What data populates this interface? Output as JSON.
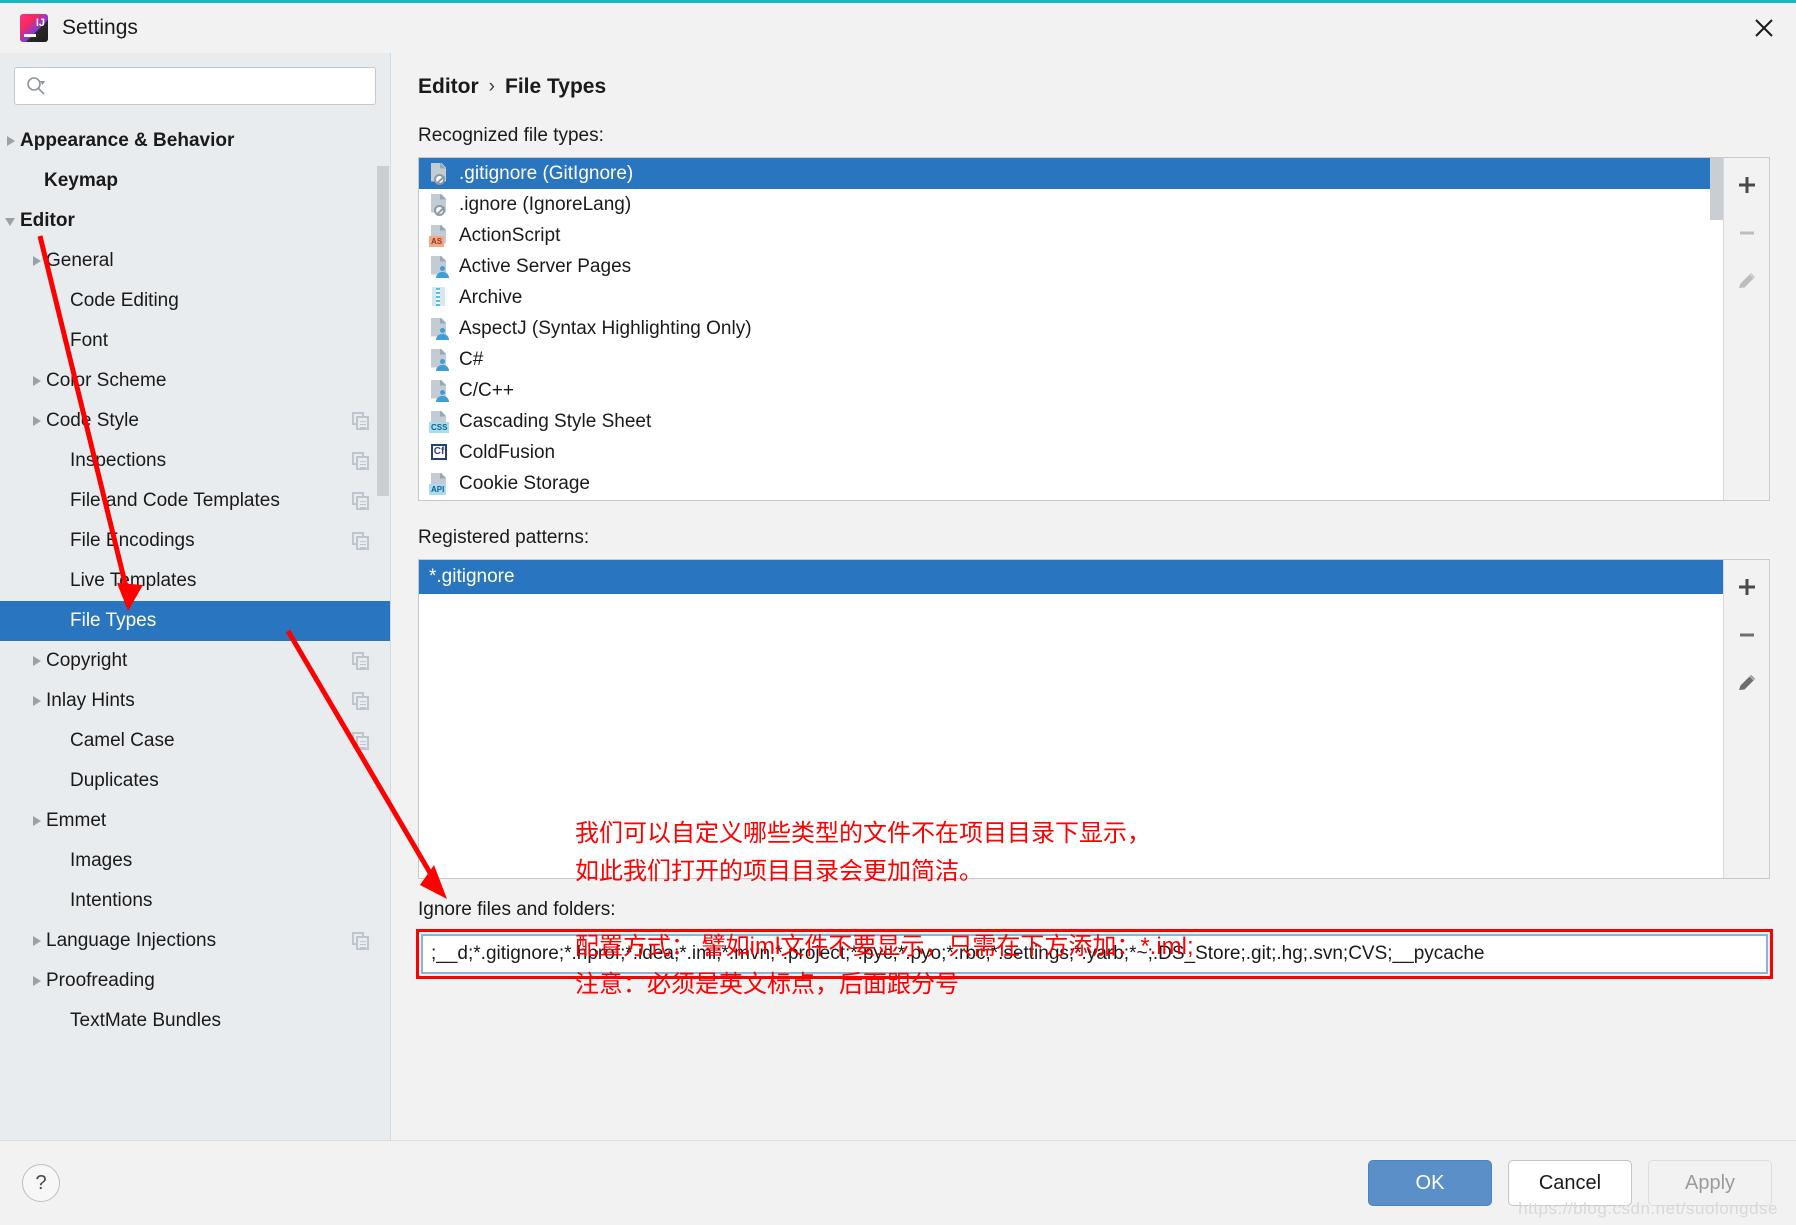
{
  "window": {
    "title": "Settings",
    "close_icon": "close-icon",
    "logo": "intellij-idea-logo"
  },
  "sidebar": {
    "search": {
      "placeholder": "",
      "value": "",
      "icon": "search-icon"
    },
    "items": [
      {
        "label": "Appearance & Behavior",
        "arrow": "closed",
        "bold": true,
        "indent": 20,
        "copy": false,
        "selected": false
      },
      {
        "label": "Keymap",
        "arrow": "none",
        "bold": true,
        "indent": 44,
        "copy": false,
        "selected": false
      },
      {
        "label": "Editor",
        "arrow": "open",
        "bold": true,
        "indent": 20,
        "copy": false,
        "selected": false
      },
      {
        "label": "General",
        "arrow": "closed",
        "bold": false,
        "indent": 46,
        "copy": false,
        "selected": false
      },
      {
        "label": "Code Editing",
        "arrow": "none",
        "bold": false,
        "indent": 70,
        "copy": false,
        "selected": false
      },
      {
        "label": "Font",
        "arrow": "none",
        "bold": false,
        "indent": 70,
        "copy": false,
        "selected": false
      },
      {
        "label": "Color Scheme",
        "arrow": "closed",
        "bold": false,
        "indent": 46,
        "copy": false,
        "selected": false
      },
      {
        "label": "Code Style",
        "arrow": "closed",
        "bold": false,
        "indent": 46,
        "copy": true,
        "selected": false
      },
      {
        "label": "Inspections",
        "arrow": "none",
        "bold": false,
        "indent": 70,
        "copy": true,
        "selected": false
      },
      {
        "label": "File and Code Templates",
        "arrow": "none",
        "bold": false,
        "indent": 70,
        "copy": true,
        "selected": false
      },
      {
        "label": "File Encodings",
        "arrow": "none",
        "bold": false,
        "indent": 70,
        "copy": true,
        "selected": false
      },
      {
        "label": "Live Templates",
        "arrow": "none",
        "bold": false,
        "indent": 70,
        "copy": false,
        "selected": false
      },
      {
        "label": "File Types",
        "arrow": "none",
        "bold": false,
        "indent": 70,
        "copy": false,
        "selected": true
      },
      {
        "label": "Copyright",
        "arrow": "closed",
        "bold": false,
        "indent": 46,
        "copy": true,
        "selected": false
      },
      {
        "label": "Inlay Hints",
        "arrow": "closed",
        "bold": false,
        "indent": 46,
        "copy": true,
        "selected": false
      },
      {
        "label": "Camel Case",
        "arrow": "none",
        "bold": false,
        "indent": 70,
        "copy": true,
        "selected": false
      },
      {
        "label": "Duplicates",
        "arrow": "none",
        "bold": false,
        "indent": 70,
        "copy": false,
        "selected": false
      },
      {
        "label": "Emmet",
        "arrow": "closed",
        "bold": false,
        "indent": 46,
        "copy": false,
        "selected": false
      },
      {
        "label": "Images",
        "arrow": "none",
        "bold": false,
        "indent": 70,
        "copy": false,
        "selected": false
      },
      {
        "label": "Intentions",
        "arrow": "none",
        "bold": false,
        "indent": 70,
        "copy": false,
        "selected": false
      },
      {
        "label": "Language Injections",
        "arrow": "closed",
        "bold": false,
        "indent": 46,
        "copy": true,
        "selected": false
      },
      {
        "label": "Proofreading",
        "arrow": "closed",
        "bold": false,
        "indent": 46,
        "copy": false,
        "selected": false
      },
      {
        "label": "TextMate Bundles",
        "arrow": "none",
        "bold": false,
        "indent": 70,
        "copy": false,
        "selected": false
      }
    ]
  },
  "main": {
    "breadcrumb": {
      "root": "Editor",
      "separator": "›",
      "leaf": "File Types"
    },
    "recognized": {
      "label": "Recognized file types:",
      "items": [
        {
          "name": ".gitignore (GitIgnore)",
          "icon": "file-ban-icon",
          "selected": true
        },
        {
          "name": ".ignore (IgnoreLang)",
          "icon": "file-ban-icon",
          "selected": false
        },
        {
          "name": "ActionScript",
          "icon": "file-as-icon",
          "selected": false
        },
        {
          "name": "Active Server Pages",
          "icon": "file-person-icon",
          "selected": false
        },
        {
          "name": "Archive",
          "icon": "file-archive-icon",
          "selected": false
        },
        {
          "name": "AspectJ (Syntax Highlighting Only)",
          "icon": "file-person-icon",
          "selected": false
        },
        {
          "name": "C#",
          "icon": "file-person-icon",
          "selected": false
        },
        {
          "name": "C/C++",
          "icon": "file-person-icon",
          "selected": false
        },
        {
          "name": "Cascading Style Sheet",
          "icon": "file-css-icon",
          "selected": false
        },
        {
          "name": "ColdFusion",
          "icon": "file-cf-icon",
          "selected": false
        },
        {
          "name": "Cookie Storage",
          "icon": "file-api-icon",
          "selected": false
        }
      ],
      "tools": [
        {
          "name": "add-file-type-button",
          "icon": "plus-icon",
          "enabled": true
        },
        {
          "name": "remove-file-type-button",
          "icon": "minus-icon",
          "enabled": false
        },
        {
          "name": "edit-file-type-button",
          "icon": "pencil-icon",
          "enabled": false
        }
      ]
    },
    "patterns": {
      "label": "Registered patterns:",
      "items": [
        {
          "pattern": "*.gitignore",
          "selected": true
        }
      ],
      "tools": [
        {
          "name": "add-pattern-button",
          "icon": "plus-icon",
          "enabled": true
        },
        {
          "name": "remove-pattern-button",
          "icon": "minus-icon",
          "enabled": true
        },
        {
          "name": "edit-pattern-button",
          "icon": "pencil-icon",
          "enabled": true
        }
      ]
    },
    "ignore": {
      "label": "Ignore files and folders:",
      "value": "d;*.gitignore;*.hprof;*.idea;*.iml;*.mvn;*.project;*.pyc;*.pyo;*.rbc;*.settings;*.yarb;*~;.DS_Store;.git;.hg;.svn;CVS;__pycache__;"
    }
  },
  "annotations": {
    "line1": "我们可以自定义哪些类型的文件不在项目目录下显示，\n如此我们打开的项目目录会更加简洁。",
    "line2": "配置方式： 譬如iml文件不要显示，只需在下方添加：*.iml;\n注意：必须是英文标点，后面跟分号",
    "color": "#ff0000"
  },
  "footer": {
    "help_label": "?",
    "ok_label": "OK",
    "cancel_label": "Cancel",
    "apply_label": "Apply"
  },
  "watermark": "https://blog.csdn.net/suolongdse",
  "colors": {
    "accent_selection": "#2a75c0",
    "sidebar_bg": "#e8ecef",
    "panel_bg": "#f2f2f2",
    "annotation_red": "#ff0000",
    "titlebar_top_line": "#19b6c4",
    "primary_button": "#5a8fc8"
  }
}
